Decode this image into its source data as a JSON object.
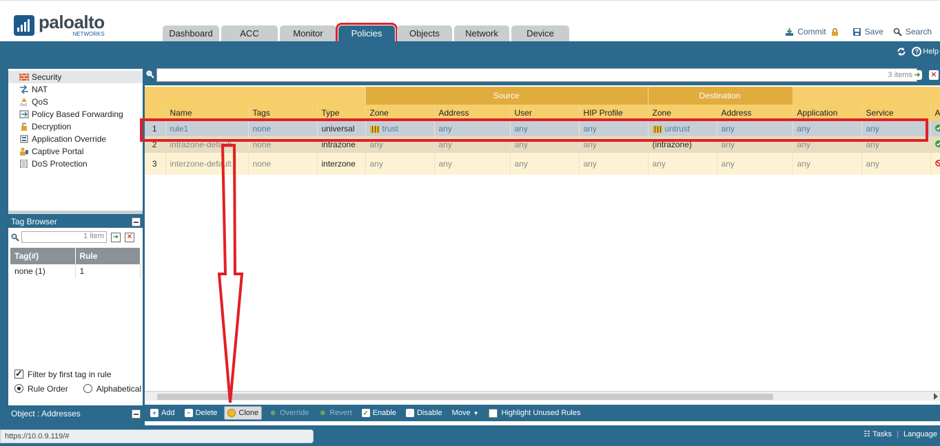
{
  "brand": {
    "name": "paloalto",
    "sub": "NETWORKS"
  },
  "nav": {
    "tabs": [
      "Dashboard",
      "ACC",
      "Monitor",
      "Policies",
      "Objects",
      "Network",
      "Device"
    ],
    "active": "Policies"
  },
  "header_tools": {
    "commit": "Commit",
    "save": "Save",
    "search": "Search"
  },
  "topbar": {
    "help": "Help"
  },
  "policy_tree": {
    "items": [
      "Security",
      "NAT",
      "QoS",
      "Policy Based Forwarding",
      "Decryption",
      "Application Override",
      "Captive Portal",
      "DoS Protection"
    ],
    "selected": "Security"
  },
  "tag_browser": {
    "title": "Tag Browser",
    "count": "1 item",
    "columns": [
      "Tag(#)",
      "Rule"
    ],
    "rows": [
      [
        "none (1)",
        "1"
      ]
    ],
    "filter_label": "Filter by first tag in rule",
    "filter_checked": true,
    "sort_options": [
      "Rule Order",
      "Alphabetical"
    ],
    "sort_selected": "Rule Order"
  },
  "object_panel": {
    "title": "Object : Addresses"
  },
  "rules_search": {
    "count": "3 items"
  },
  "rules_table": {
    "group_headers": {
      "source": "Source",
      "destination": "Destination"
    },
    "columns": [
      "",
      "Name",
      "Tags",
      "Type",
      "Zone",
      "Address",
      "User",
      "HIP Profile",
      "Zone",
      "Address",
      "Application",
      "Service",
      "A"
    ],
    "rows": [
      [
        "1",
        "rule1",
        "none",
        "universal",
        "trust",
        "any",
        "any",
        "any",
        "untrust",
        "any",
        "any",
        "any"
      ],
      [
        "2",
        "intrazone-default",
        "none",
        "intrazone",
        "any",
        "any",
        "any",
        "any",
        "(intrazone)",
        "any",
        "any",
        "any"
      ],
      [
        "3",
        "interzone-default",
        "none",
        "interzone",
        "any",
        "any",
        "any",
        "any",
        "any",
        "any",
        "any",
        "any"
      ]
    ],
    "row_actions": [
      "allow",
      "allow",
      "deny"
    ]
  },
  "actions": {
    "add": "Add",
    "delete": "Delete",
    "clone": "Clone",
    "override": "Override",
    "revert": "Revert",
    "enable": "Enable",
    "disable": "Disable",
    "move": "Move",
    "highlight_unused": "Highlight Unused Rules"
  },
  "statusbar": {
    "url": "https://10.0.9.119/#",
    "tasks": "Tasks",
    "language": "Language"
  },
  "colors": {
    "brand_blue": "#2b6a8d",
    "header_gold": "#f6cf6b",
    "group_gold": "#e0ac3d",
    "annotation_red": "#e21f26"
  },
  "icons": {
    "commit": "commit-icon",
    "lock": "lock-icon",
    "save": "save-icon",
    "search": "search-icon",
    "refresh": "refresh-icon",
    "help": "help-icon",
    "zone": "zone-icon",
    "allow": "allow-icon",
    "deny": "deny-icon"
  }
}
